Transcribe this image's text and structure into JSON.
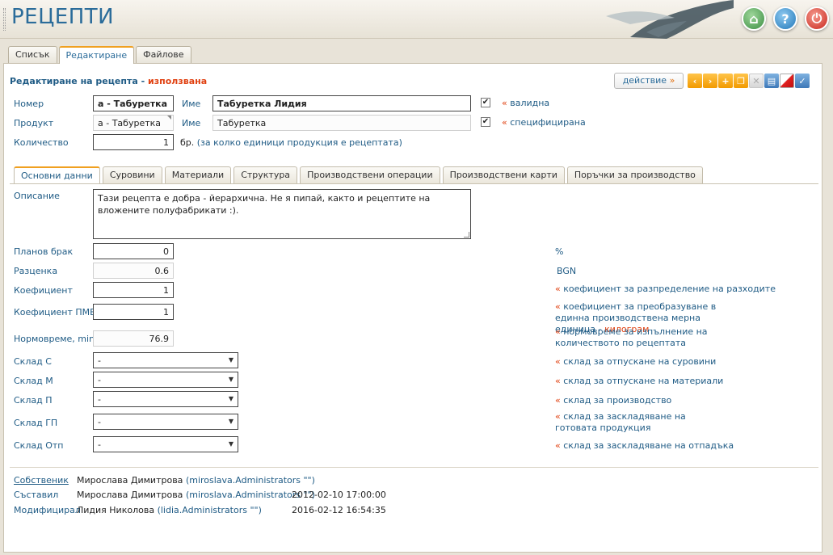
{
  "app": {
    "title": "РЕЦЕПТИ"
  },
  "header_buttons": {
    "home": "⌂",
    "help": "?",
    "power": "⏻"
  },
  "top_tabs": [
    "Списък",
    "Редактиране",
    "Файлове"
  ],
  "section": {
    "title": "Редактиране на рецепта",
    "separator": "-",
    "status": "използвана"
  },
  "action": {
    "label": "действие",
    "arrow": "»"
  },
  "toolbar_icons": [
    "chevron-left-icon",
    "chevron-right-icon",
    "add-icon",
    "copy-icon",
    "close-icon",
    "print-icon",
    "cancel-icon",
    "save-icon"
  ],
  "form": {
    "number_label": "Номер",
    "number_value": "а - Табуретка",
    "name_label": "Име",
    "name_value": "Табуретка Лидия",
    "valid_label": "валидна",
    "product_label": "Продукт",
    "product_value": "а - Табуретка",
    "product_name_label": "Име",
    "product_name_value": "Табуретка",
    "specified_label": "специфицирана",
    "quantity_label": "Количество",
    "quantity_value": "1",
    "quantity_unit": "бр.",
    "quantity_hint": "(за колко единици продукция е рецептата)",
    "quote_mark": "«"
  },
  "inner_tabs": [
    "Основни данни",
    "Суровини",
    "Материали",
    "Структура",
    "Производствени операции",
    "Производствени карти",
    "Поръчки за производство"
  ],
  "basic": {
    "description_label": "Описание",
    "description_value": "Тази рецепта е добра - йерархична. Не я пипай, както и рецептите на вложените полуфабрикати :).",
    "planned_defect_label": "Планов брак",
    "planned_defect_value": "0",
    "planned_defect_unit": "%",
    "cost_label": "Разценка",
    "cost_value": "0.6",
    "cost_unit": "BGN",
    "coef_label": "Коефициент",
    "coef_value": "1",
    "coef_hint": "коефициент за разпределение на разходите",
    "coef_pme_label": "Коефициент ПМЕ",
    "coef_pme_value": "1",
    "coef_pme_hint": "коефициент за преобразуване в единна производствена мерна единица -",
    "coef_pme_unit": "килограм",
    "norm_label": "Нормовреме, min",
    "norm_value": "76.9",
    "norm_hint": "нормовреме за изпълнение на количеството по рецептата",
    "warehouse_s_label": "Склад С",
    "warehouse_s_value": "-",
    "warehouse_s_hint": "склад за отпускане на суровини",
    "warehouse_m_label": "Склад М",
    "warehouse_m_value": "-",
    "warehouse_m_hint": "склад за отпускане на материали",
    "warehouse_p_label": "Склад П",
    "warehouse_p_value": "-",
    "warehouse_p_hint": "склад за производство",
    "warehouse_gp_label": "Склад ГП",
    "warehouse_gp_value": "-",
    "warehouse_gp_hint": "склад за заскладяване на готовата продукция",
    "warehouse_otp_label": "Склад Отп",
    "warehouse_otp_value": "-",
    "warehouse_otp_hint": "склад за заскладяване на отпадъка"
  },
  "footer": {
    "owner_label": "Собственик",
    "owner_name": "Мирослава Димитрова",
    "owner_account": "(miroslava.Administrators \"\")",
    "created_label": "Съставил",
    "created_name": "Мирослава Димитрова",
    "created_account": "(miroslava.Administrators \"\")",
    "created_date": "2012-02-10 17:00:00",
    "modified_label": "Модифицирал",
    "modified_name": "Лидия Николова",
    "modified_account": "(lidia.Administrators \"\")",
    "modified_date": "2016-02-12 16:54:35"
  },
  "colors": {
    "accent": "#1f5b85",
    "warning": "#e04010",
    "tab_highlight": "#f0a020",
    "background": "#e8e3d8"
  }
}
